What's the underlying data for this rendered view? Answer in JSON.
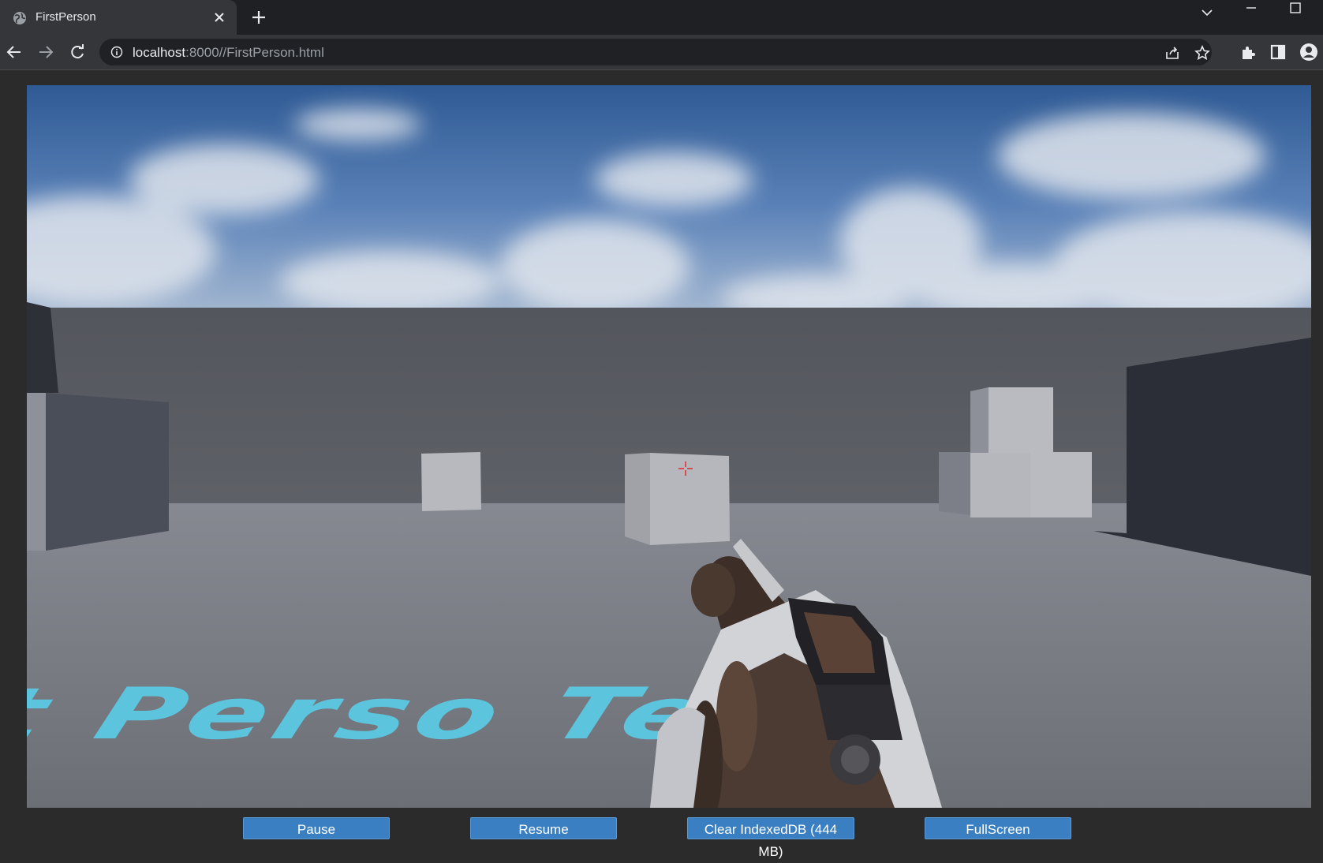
{
  "browser": {
    "tab_title": "FirstPerson",
    "url_host": "localhost",
    "url_rest": ":8000//FirstPerson.html"
  },
  "game": {
    "floor_text": "t Perso   Tem"
  },
  "controls": {
    "pause_label": "Pause",
    "resume_label": "Resume",
    "clear_label": "Clear IndexedDB (444 MB)",
    "fullscreen_label": "FullScreen"
  },
  "colors": {
    "chrome_bg": "#1f2023",
    "toolbar_bg": "#35363a",
    "button_blue": "#3a7fc2",
    "floor_text": "#5cc4dc",
    "crosshair": "#e0303a"
  }
}
